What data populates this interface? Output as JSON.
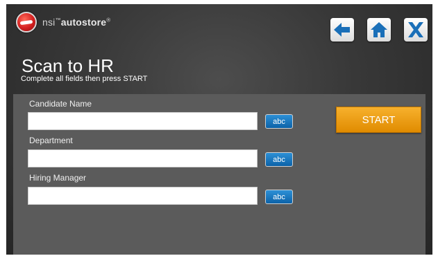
{
  "brand": {
    "prefix": "nsi",
    "tm": "™",
    "name": "autostore",
    "reg": "®"
  },
  "nav": {
    "back_icon": "arrow-left-icon",
    "home_icon": "home-icon",
    "close_icon": "close-x-icon",
    "accent": "#1a6fb8"
  },
  "page": {
    "title": "Scan to HR",
    "subtitle": "Complete all fields then press START"
  },
  "fields": [
    {
      "label": "Candidate Name",
      "value": "",
      "keyboard_label": "abc"
    },
    {
      "label": "Department",
      "value": "",
      "keyboard_label": "abc"
    },
    {
      "label": "Hiring Manager",
      "value": "",
      "keyboard_label": "abc"
    }
  ],
  "start": {
    "label": "START",
    "color": "#f0a020"
  }
}
